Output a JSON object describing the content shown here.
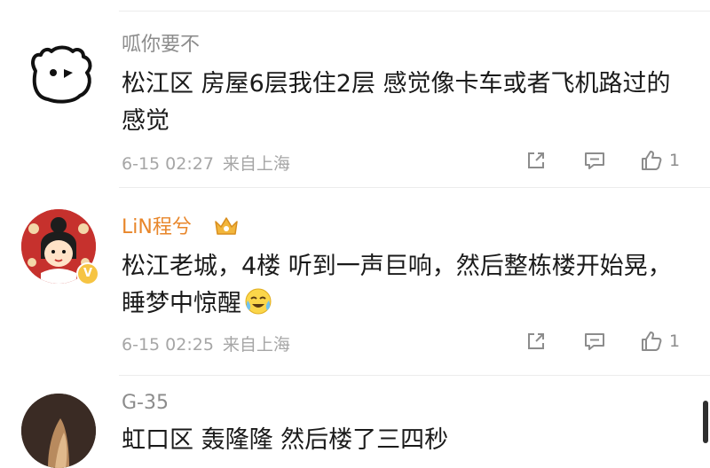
{
  "comments": [
    {
      "username": "呱你要不",
      "content": "松江区 房屋6层我住2层 感觉像卡车或者飞机路过的感觉",
      "time": "6-15 02:27",
      "location": "来自上海",
      "likes": "1",
      "avatar_icon": "bear-cartoon-avatar",
      "verified": false
    },
    {
      "username": "LiN程兮",
      "content": "松江老城，4楼 听到一声巨响，然后整栋楼开始晃，睡梦中惊醒",
      "time": "6-15 02:25",
      "location": "来自上海",
      "likes": "1",
      "avatar_icon": "cartoon-girl-avatar",
      "verified": true,
      "verified_badge": "V",
      "badge_icon": "crown-icon",
      "emoji": "crying-laughing-emoji"
    },
    {
      "username": "G-35",
      "content": "虹口区 轰隆隆 然后楼了三四秒",
      "avatar_icon": "photo-avatar"
    }
  ],
  "icons": {
    "share": "share-icon",
    "reply": "comment-icon",
    "like": "thumbs-up-icon"
  },
  "colors": {
    "username": "#8c8c8c",
    "vip_username": "#e8862a",
    "text": "#1a1a1a",
    "meta": "#a6a6a6",
    "divider": "#ececec"
  }
}
